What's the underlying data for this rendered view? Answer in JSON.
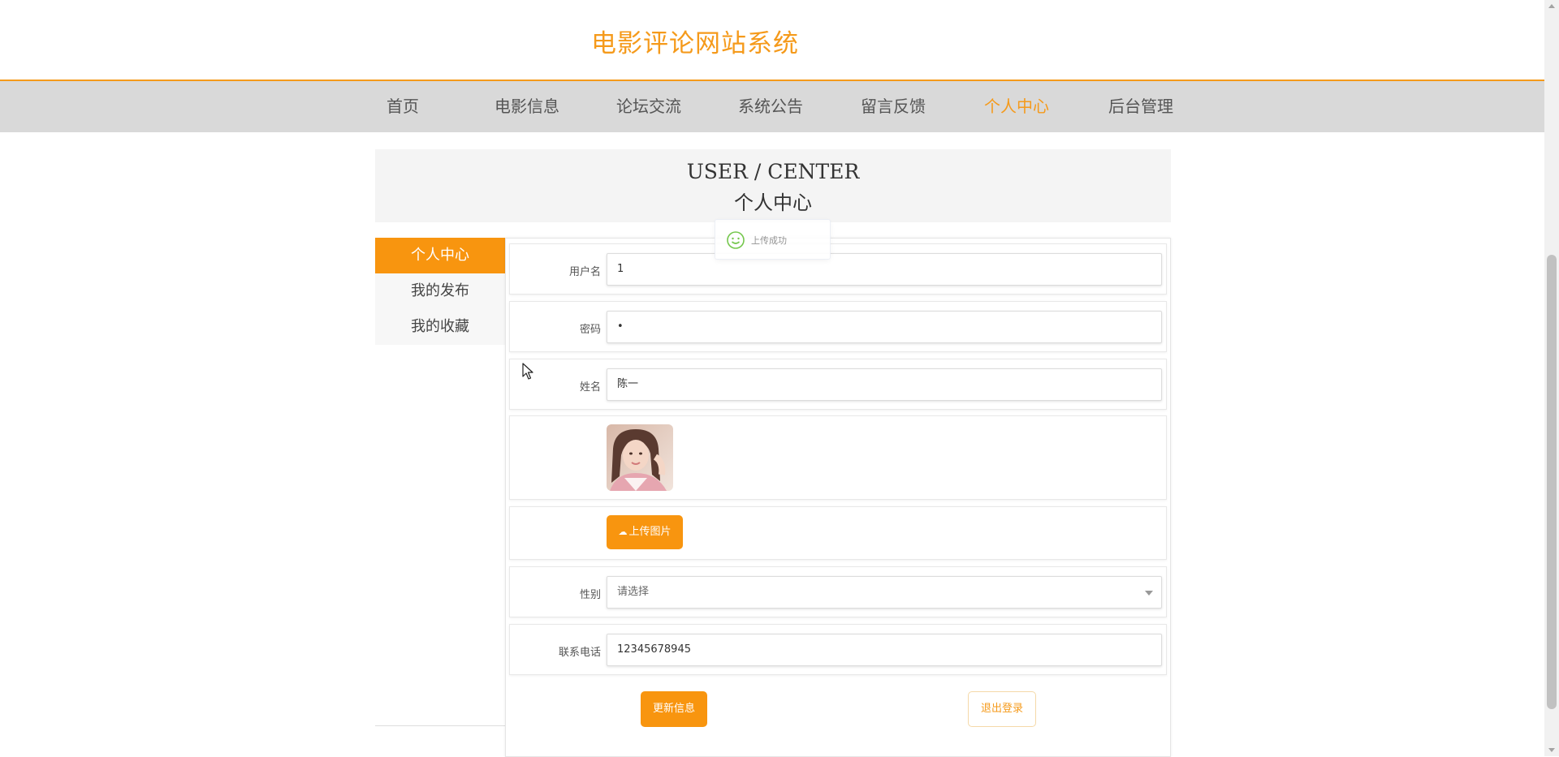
{
  "site": {
    "title": "电影评论网站系统"
  },
  "nav": {
    "items": [
      {
        "label": "首页"
      },
      {
        "label": "电影信息"
      },
      {
        "label": "论坛交流"
      },
      {
        "label": "系统公告"
      },
      {
        "label": "留言反馈"
      },
      {
        "label": "个人中心",
        "active": true
      },
      {
        "label": "后台管理"
      }
    ]
  },
  "banner": {
    "en": "USER / CENTER",
    "cn": "个人中心"
  },
  "sidebar": {
    "items": [
      {
        "label": "个人中心",
        "active": true
      },
      {
        "label": "我的发布"
      },
      {
        "label": "我的收藏"
      }
    ]
  },
  "form": {
    "username": {
      "label": "用户名",
      "value": "1"
    },
    "password": {
      "label": "密码",
      "value": "•"
    },
    "name": {
      "label": "姓名",
      "value": "陈一"
    },
    "upload_label": "上传图片",
    "gender": {
      "label": "性别",
      "placeholder": "请选择"
    },
    "phone": {
      "label": "联系电话",
      "value": "12345678945"
    },
    "update_label": "更新信息",
    "logout_label": "退出登录"
  },
  "toast": {
    "message": "上传成功"
  },
  "colors": {
    "accent": "#f8950f",
    "nav_bg": "#d9d9d9"
  }
}
